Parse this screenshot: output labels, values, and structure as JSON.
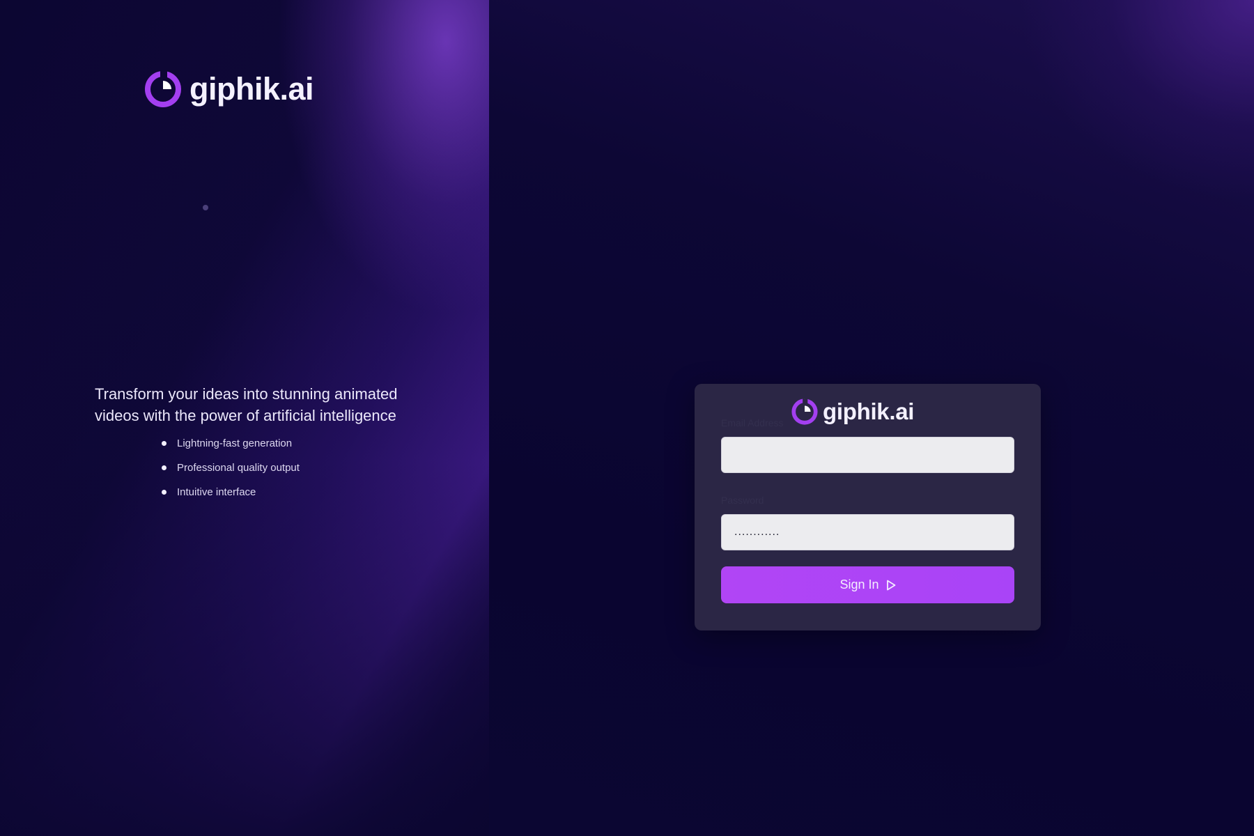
{
  "brand": {
    "name": "giphik.ai",
    "logo_icon": "giphik-logo-ring-icon",
    "accent_color": "#a944f7"
  },
  "hero": {
    "tagline": "Transform your ideas into stunning animated videos with the power of artificial intelligence",
    "features": [
      "Lightning-fast generation",
      "Professional quality output",
      "Intuitive interface"
    ]
  },
  "login": {
    "email_label": "Email Address",
    "email_value": "",
    "password_label": "Password",
    "password_value": "............",
    "signin_label": "Sign In",
    "signin_icon": "play-outline-icon"
  }
}
